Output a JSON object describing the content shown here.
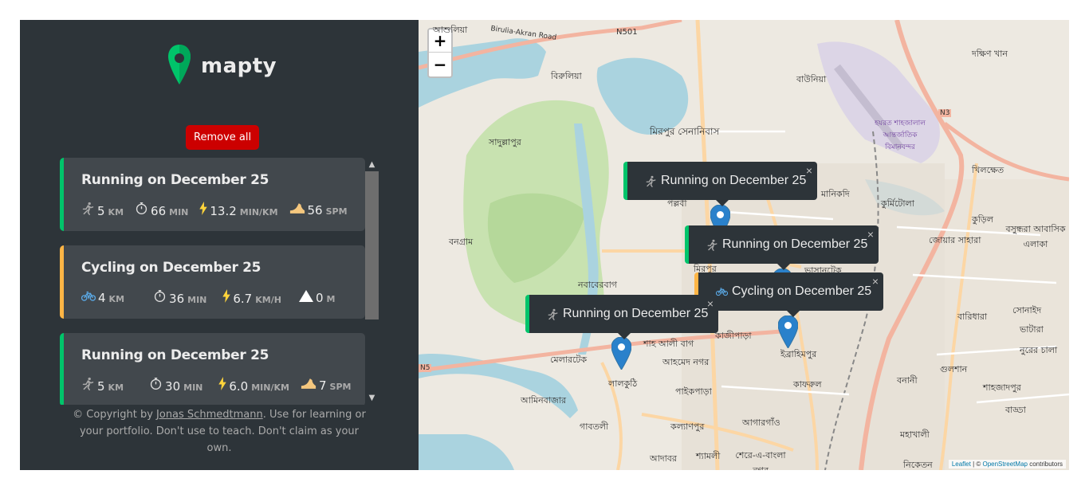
{
  "app": {
    "logo_text": "mapty"
  },
  "sidebar": {
    "remove_all_label": "Remove all",
    "workouts": [
      {
        "title": "Running on December 25",
        "type": "running",
        "details": [
          {
            "icon": "runner-icon",
            "value": "5",
            "unit": "KM"
          },
          {
            "icon": "stopwatch-icon",
            "value": "66",
            "unit": "MIN"
          },
          {
            "icon": "lightning-icon",
            "value": "13.2",
            "unit": "MIN/KM"
          },
          {
            "icon": "footprint-icon",
            "value": "56",
            "unit": "SPM"
          }
        ]
      },
      {
        "title": "Cycling on December 25",
        "type": "cycling",
        "details": [
          {
            "icon": "bicycle-icon",
            "value": "4",
            "unit": "KM"
          },
          {
            "icon": "stopwatch-icon",
            "value": "36",
            "unit": "MIN"
          },
          {
            "icon": "lightning-icon",
            "value": "6.7",
            "unit": "KM/H"
          },
          {
            "icon": "mountain-icon",
            "value": "0",
            "unit": "M"
          }
        ]
      },
      {
        "title": "Running on December 25",
        "type": "running",
        "details": [
          {
            "icon": "runner-icon",
            "value": "5",
            "unit": "KM"
          },
          {
            "icon": "stopwatch-icon",
            "value": "30",
            "unit": "MIN"
          },
          {
            "icon": "lightning-icon",
            "value": "6.0",
            "unit": "MIN/KM"
          },
          {
            "icon": "footprint-icon",
            "value": "7",
            "unit": "SPM"
          }
        ]
      }
    ],
    "copyright": {
      "prefix": "© Copyright by ",
      "author": "Jonas Schmedtmann",
      "suffix": ". Use for learning or your portfolio. Don't use to teach. Don't claim as your own."
    }
  },
  "map": {
    "zoom_in": "+",
    "zoom_out": "−",
    "popups": [
      {
        "text": "Running on December 25",
        "type": "running",
        "close": "×"
      },
      {
        "text": "Running on December 25",
        "type": "running",
        "close": "×"
      },
      {
        "text": "Cycling on December 25",
        "type": "cycling",
        "close": "×"
      },
      {
        "text": "Running on December 25",
        "type": "running",
        "close": "×"
      }
    ],
    "attribution": {
      "leaflet": "Leaflet",
      "sep": " | © ",
      "osm": "OpenStreetMap",
      "suffix": " contributors"
    },
    "labels": [
      "আশুলিয়া",
      "Birulia-Akran Road",
      "N501",
      "বিরুলিয়া",
      "বাউনিয়া",
      "দক্ষিণ খান",
      "মিরপুর সেনানিবাস",
      "সাদুল্লাপুর",
      "হযরত শাহজালাল আন্তর্জাতিক বিমানবন্দর",
      "N3",
      "খিলক্ষেত",
      "পল্লবী",
      "মানিকদি",
      "কুর্মিটোলা",
      "কুড়িল",
      "বনগ্রাম",
      "জোয়ার সাহারা",
      "বসুন্ধরা আবাসিক এলাকা",
      "নবাবেরবাগ",
      "মিরপুর",
      "ভাসানটেক",
      "সোনাইদ",
      "বারিধারা",
      "কাজীপাড়া",
      "ইব্রাহিমপুর",
      "শাহ আলী বাগ",
      "মেলারটেক",
      "আহমেদ নগর",
      "লালকুঠি",
      "পাইকপাড়া",
      "কাফরুল",
      "বনানী",
      "গুলশান",
      "শাহজাদপুর",
      "নুরের চালা",
      "ভাটারা",
      "N5",
      "আমিনবাজার",
      "গাবতলী",
      "কল্যাণপুর",
      "আগারগাঁও",
      "বাড্ডা",
      "মহাখালী",
      "আদাবর",
      "শ্যামলী",
      "শেরে-এ-বাংলা নগর",
      "নিকেতন"
    ]
  },
  "colors": {
    "running": "#00c46a",
    "cycling": "#ffb545",
    "danger": "#cc0000",
    "dark1": "#2d3439",
    "dark2": "#42484d"
  }
}
